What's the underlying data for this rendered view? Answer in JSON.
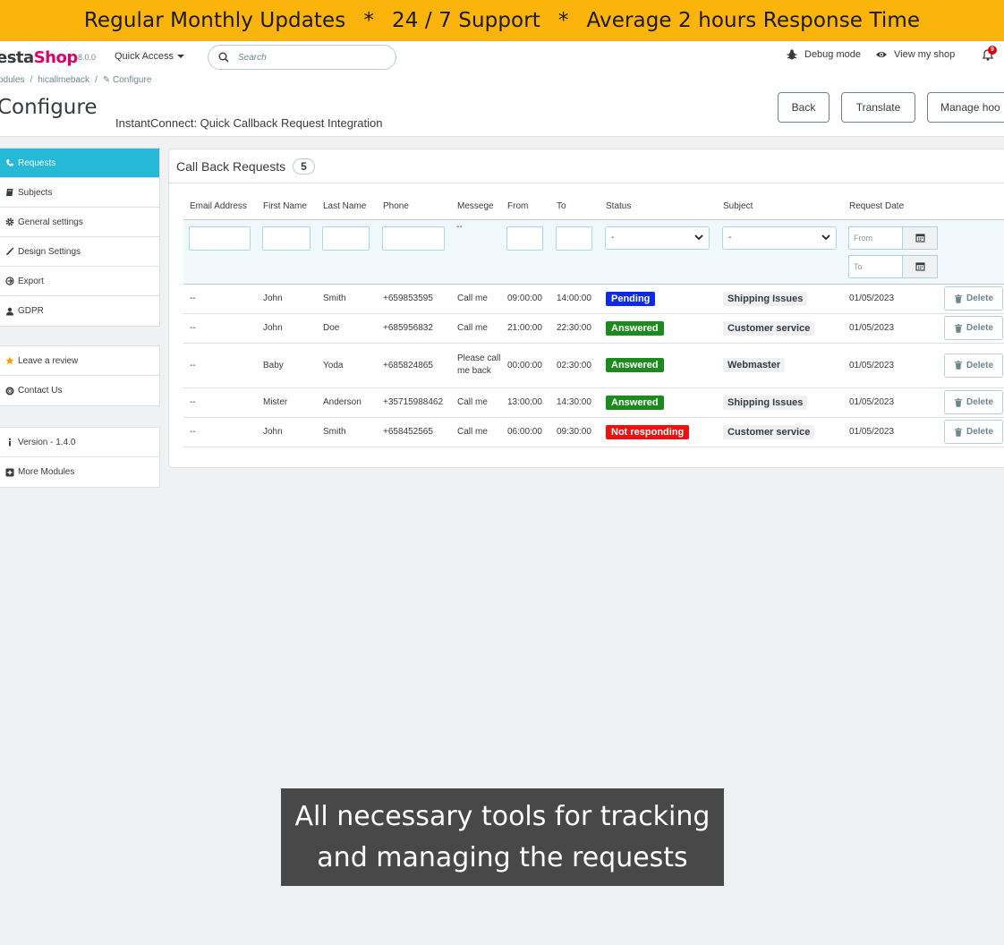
{
  "promo": {
    "item1": "Regular Monthly Updates",
    "sep": "*",
    "item2": "24 / 7 Support",
    "item3": "Average 2 hours Response Time"
  },
  "header": {
    "logo_part1": "estaShop",
    "logo_part1_dark": "esta",
    "logo_part1_pink": "Shop",
    "version": "8.0.0",
    "quick_access": "Quick Access",
    "search_placeholder": "Search",
    "debug_mode": "Debug mode",
    "view_shop": "View my shop",
    "notifications_count": "9"
  },
  "breadcrumb": {
    "item1": "odules",
    "item2": "hicallmeback",
    "item3": "Configure"
  },
  "page": {
    "title": "Configure",
    "subtitle": "InstantConnect: Quick Callback Request Integration"
  },
  "toolbar": {
    "back": "Back",
    "translate": "Translate",
    "manage_hooks": "Manage hoo"
  },
  "sidebar": {
    "group1": [
      {
        "label": "Requests",
        "icon": "phone-icon",
        "active": true
      },
      {
        "label": "Subjects",
        "icon": "book-icon"
      },
      {
        "label": "General settings",
        "icon": "gear-icon"
      },
      {
        "label": "Design Settings",
        "icon": "brush-icon"
      },
      {
        "label": "Export",
        "icon": "export-icon"
      },
      {
        "label": "GDPR",
        "icon": "user-icon"
      }
    ],
    "group2": [
      {
        "label": "Leave a review",
        "icon": "star-icon"
      },
      {
        "label": "Contact Us",
        "icon": "lifebuoy-icon"
      }
    ],
    "group3": [
      {
        "label": "Version - 1.4.0",
        "icon": "info-icon"
      },
      {
        "label": "More Modules",
        "icon": "plus-square-icon"
      }
    ]
  },
  "panel": {
    "title": "Call Back Requests",
    "count": "5"
  },
  "table": {
    "headers": [
      "Email Address",
      "First Name",
      "Last Name",
      "Phone",
      "Messege",
      "From",
      "To",
      "Status",
      "Subject",
      "Request Date"
    ],
    "filters": {
      "message_placeholder": "--",
      "status_selected": "-",
      "subject_selected": "-",
      "date_from_placeholder": "From",
      "date_to_placeholder": "To"
    },
    "rows": [
      {
        "email": "--",
        "first": "John",
        "last": "Smith",
        "phone": "+659853595",
        "message": "Call me",
        "from": "09:00:00",
        "to": "14:00:00",
        "status": "Pending",
        "subject": "Shipping Issues",
        "date": "01/05/2023",
        "delete": "Delete"
      },
      {
        "email": "--",
        "first": "John",
        "last": "Doe",
        "phone": "+685956832",
        "message": "Call me",
        "from": "21:00:00",
        "to": "22:30:00",
        "status": "Answered",
        "subject": "Customer service",
        "date": "01/05/2023",
        "delete": "Delete"
      },
      {
        "email": "--",
        "first": "Baby",
        "last": "Yoda",
        "phone": "+685824865",
        "message": "Please call me back",
        "from": "00:00:00",
        "to": "02:30:00",
        "status": "Answered",
        "subject": "Webmaster",
        "date": "01/05/2023",
        "delete": "Delete"
      },
      {
        "email": "--",
        "first": "Mister",
        "last": "Anderson",
        "phone": "+35715988462",
        "message": "Call me",
        "from": "13:00:00",
        "to": "14:30:00",
        "status": "Answered",
        "subject": "Shipping Issues",
        "date": "01/05/2023",
        "delete": "Delete"
      },
      {
        "email": "--",
        "first": "John",
        "last": "Smith",
        "phone": "+658452565",
        "message": "Call me",
        "from": "06:00:00",
        "to": "09:30:00",
        "status": "Not responding",
        "subject": "Customer service",
        "date": "01/05/2023",
        "delete": "Delete"
      }
    ]
  },
  "status_colors": {
    "Pending": "#0d2be5",
    "Answered": "#1d8a1d",
    "Not responding": "#ee1111"
  },
  "caption": {
    "line1": "All necessary tools for tracking",
    "line2": "and managing the requests"
  }
}
